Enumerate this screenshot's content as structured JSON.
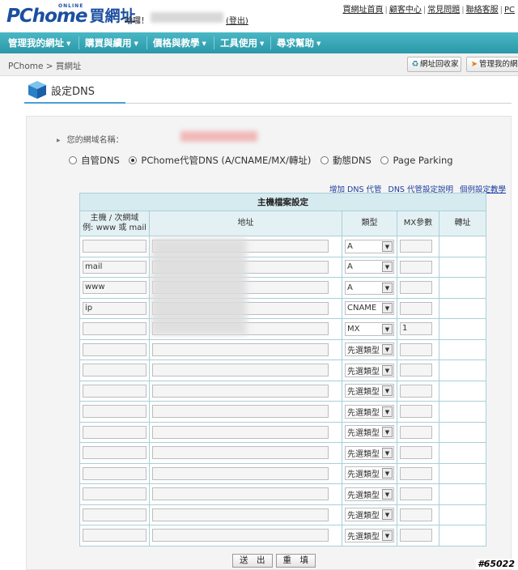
{
  "header": {
    "logo_text": "PChome",
    "logo_online": "ONLINE",
    "logo_brand": "買網址",
    "greeting": "哈囉！",
    "logout": "(登出)",
    "top_links": [
      "買網址首頁",
      "顧客中心",
      "常見問題",
      "聯絡客服",
      "PC"
    ]
  },
  "nav": {
    "items": [
      "管理我的網址",
      "購買與續用",
      "價格與教學",
      "工具使用",
      "尋求幫助"
    ]
  },
  "breadcrumb": {
    "path": "PChome > 買網址",
    "btn_recycle": "網址回收家",
    "btn_manage": "管理我的網址"
  },
  "page": {
    "title": "設定DNS"
  },
  "form": {
    "domain_label": "您的網域名稱：",
    "radio_options": [
      "自管DNS",
      "PChome代管DNS (A/CNAME/MX/轉址)",
      "動態DNS",
      "Page Parking"
    ],
    "selected_radio": 1,
    "links": [
      "增加 DNS 代管",
      "DNS 代管設定說明",
      "個例設定教學"
    ],
    "table_title": "主機檔案設定",
    "col_host_1": "主機 / 次網域",
    "col_host_2": "例: www 或 mail",
    "col_addr": "地址",
    "col_type": "類型",
    "col_mx": "MX參數",
    "col_redirect": "轉址",
    "rows": [
      {
        "host": "",
        "type": "A",
        "mx": ""
      },
      {
        "host": "mail",
        "type": "A",
        "mx": ""
      },
      {
        "host": "www",
        "type": "A",
        "mx": ""
      },
      {
        "host": "ip",
        "type": "CNAME",
        "mx": ""
      },
      {
        "host": "",
        "type": "MX",
        "mx": "1"
      },
      {
        "host": "",
        "type": "先選類型",
        "mx": ""
      },
      {
        "host": "",
        "type": "先選類型",
        "mx": ""
      },
      {
        "host": "",
        "type": "先選類型",
        "mx": ""
      },
      {
        "host": "",
        "type": "先選類型",
        "mx": ""
      },
      {
        "host": "",
        "type": "先選類型",
        "mx": ""
      },
      {
        "host": "",
        "type": "先選類型",
        "mx": ""
      },
      {
        "host": "",
        "type": "先選類型",
        "mx": ""
      },
      {
        "host": "",
        "type": "先選類型",
        "mx": ""
      },
      {
        "host": "",
        "type": "先選類型",
        "mx": ""
      },
      {
        "host": "",
        "type": "先選類型",
        "mx": ""
      }
    ],
    "submit": "送　出",
    "reset": "重　填"
  },
  "watermark": "#65022",
  "colors": {
    "nav_bg": "#2a98a8",
    "link": "#1a3d9e",
    "brand": "#1b4fa0",
    "table_border": "#a9cfd8"
  }
}
